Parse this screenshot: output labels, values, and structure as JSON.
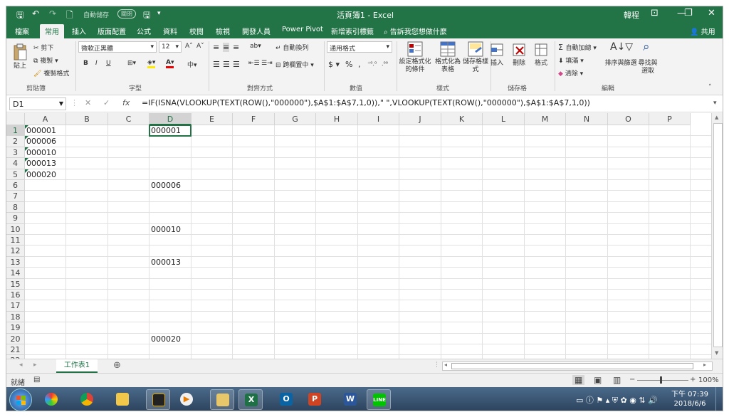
{
  "titlebar": {
    "autosave": "自動儲存",
    "autosave_state": "關閉",
    "title": "活頁簿1 - Excel",
    "user": "韓程",
    "controls": {
      "ribbon_display": "⊡",
      "minimize": "—",
      "restore": "❐",
      "close": "✕"
    }
  },
  "tabs": [
    "檔案",
    "常用",
    "插入",
    "版面配置",
    "公式",
    "資料",
    "校閱",
    "檢視",
    "開發人員",
    "Power Pivot",
    "新增索引標籤"
  ],
  "active_tab": "常用",
  "tell_me": "告訴我您想做什麼",
  "share": "共用",
  "ribbon": {
    "clipboard": {
      "paste": "貼上",
      "cut": "剪下",
      "copy": "複製",
      "format_painter": "複製格式",
      "group": "剪貼簿"
    },
    "font": {
      "name": "微軟正黑體",
      "size": "12",
      "bold": "B",
      "italic": "I",
      "underline": "U",
      "group": "字型",
      "grow": "A˄",
      "shrink": "A˅"
    },
    "alignment": {
      "wrap": "自動換列",
      "merge": "跨欄置中",
      "group": "對齊方式"
    },
    "number": {
      "format": "通用格式",
      "currency": "$",
      "percent": "%",
      "comma": ",",
      "group": "數值"
    },
    "styles": {
      "conditional": "設定格式化的條件",
      "table": "格式化為表格",
      "cell": "儲存格樣式",
      "group": "樣式"
    },
    "cells": {
      "insert": "插入",
      "delete": "刪除",
      "format": "格式",
      "group": "儲存格"
    },
    "editing": {
      "autosum": "自動加總",
      "fill": "填滿",
      "clear": "清除",
      "sort": "排序與篩選",
      "find": "尋找與選取",
      "group": "編輯"
    }
  },
  "formula_bar": {
    "name_box": "D1",
    "fx": "fx",
    "formula": "=IF(ISNA(VLOOKUP(TEXT(ROW(),\"000000\"),$A$1:$A$7,1,0)),\" \",VLOOKUP(TEXT(ROW(),\"000000\"),$A$1:$A$7,1,0))"
  },
  "columns": [
    "A",
    "B",
    "C",
    "D",
    "E",
    "F",
    "G",
    "H",
    "I",
    "J",
    "K",
    "L",
    "M",
    "N",
    "O",
    "P"
  ],
  "rows": [
    "1",
    "2",
    "3",
    "4",
    "5",
    "6",
    "7",
    "8",
    "9",
    "10",
    "11",
    "12",
    "13",
    "14",
    "15",
    "16",
    "17",
    "18",
    "19",
    "20",
    "21",
    "22"
  ],
  "selected_cell": "D1",
  "cells": {
    "A1": "000001",
    "A2": "000006",
    "A3": "000010",
    "A4": "000013",
    "A5": "000020",
    "D1": "000001",
    "D6": "000006",
    "D10": "000010",
    "D13": "000013",
    "D20": "000020"
  },
  "sheet_tab": "工作表1",
  "status": {
    "ready": "就緒",
    "zoom": "100%"
  },
  "clock": {
    "time": "下午 07:39",
    "date": "2018/6/6"
  },
  "colors": {
    "excel_green": "#227447",
    "selection": "#217346"
  }
}
